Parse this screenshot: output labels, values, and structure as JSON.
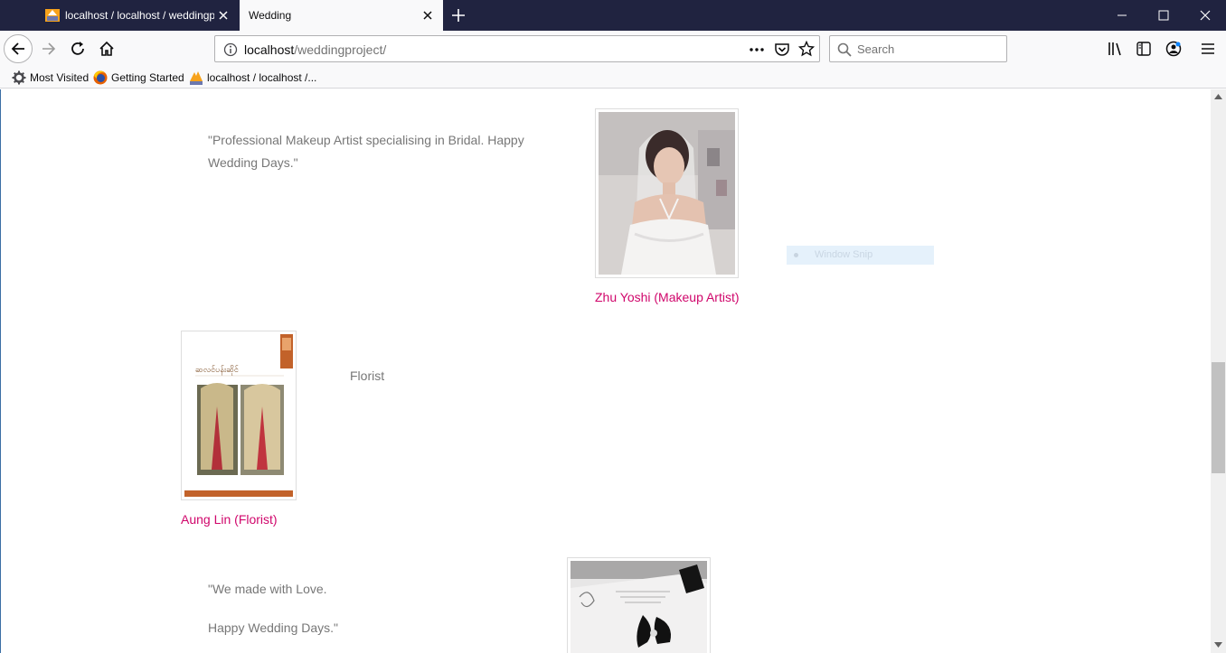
{
  "browser": {
    "tabs": [
      {
        "title": "localhost / localhost / weddingproj",
        "active": false
      },
      {
        "title": "Wedding",
        "active": true
      }
    ],
    "url_host": "localhost",
    "url_path": "/weddingproject/",
    "search_placeholder": "Search",
    "bookmarks": [
      {
        "label": "Most Visited",
        "icon": "gear-icon"
      },
      {
        "label": "Getting Started",
        "icon": "firefox-icon"
      },
      {
        "label": "localhost / localhost /...",
        "icon": "phpmyadmin-icon"
      }
    ]
  },
  "snip_overlay": {
    "label": "Window Snip"
  },
  "vendors": [
    {
      "quote": "\"Professional Makeup Artist specialising in Bridal. Happy Wedding Days.\"",
      "name": "Zhu Yoshi (Makeup Artist)",
      "photo": "bride-portrait-photo"
    },
    {
      "quote": "Florist",
      "name": "Aung Lin (Florist)",
      "photo": "florist-brochure-photo",
      "brochure_title": "ဆလင်ပန်းဆိုင်"
    },
    {
      "quote_line1": "\"We made with Love.",
      "quote_line2": "Happy Wedding Days.\"",
      "photo": "invitation-card-photo"
    }
  ],
  "colors": {
    "titlebar": "#202340",
    "vendor_link": "#d0066b",
    "quote_text": "#777777"
  }
}
